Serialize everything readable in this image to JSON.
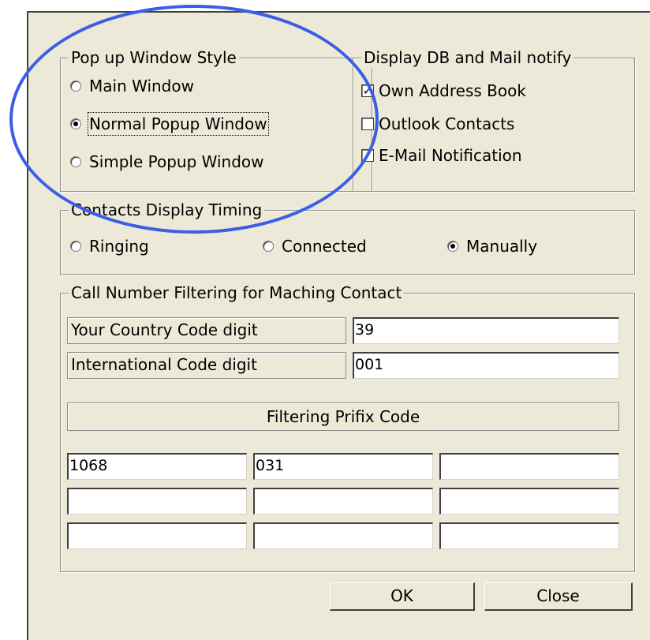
{
  "popup_style": {
    "title": "Pop up Window Style",
    "options": [
      {
        "label": "Main Window",
        "selected": false
      },
      {
        "label": "Normal Popup Window",
        "selected": true
      },
      {
        "label": "Simple Popup Window",
        "selected": false
      }
    ]
  },
  "display_db": {
    "title": "Display DB and Mail notify",
    "items": [
      {
        "label": "Own Address Book",
        "checked": true
      },
      {
        "label": "Outlook Contacts",
        "checked": false
      },
      {
        "label": "E-Mail Notification",
        "checked": false
      }
    ]
  },
  "timing": {
    "title": "Contacts Display Timing",
    "options": [
      {
        "label": "Ringing",
        "selected": false
      },
      {
        "label": "Connected",
        "selected": false
      },
      {
        "label": "Manually",
        "selected": true
      }
    ]
  },
  "filtering": {
    "title": "Call Number Filtering for Maching Contact",
    "country_label": "Your Country Code digit",
    "country_value": "39",
    "intl_label": "International Code digit",
    "intl_value": "001",
    "prefix_header": "Filtering Prifix Code",
    "prefix_values": [
      "1068",
      "031",
      "",
      "",
      "",
      "",
      "",
      "",
      ""
    ]
  },
  "buttons": {
    "ok": "OK",
    "close": "Close"
  },
  "annotation": {
    "color": "#3a5ee6"
  }
}
